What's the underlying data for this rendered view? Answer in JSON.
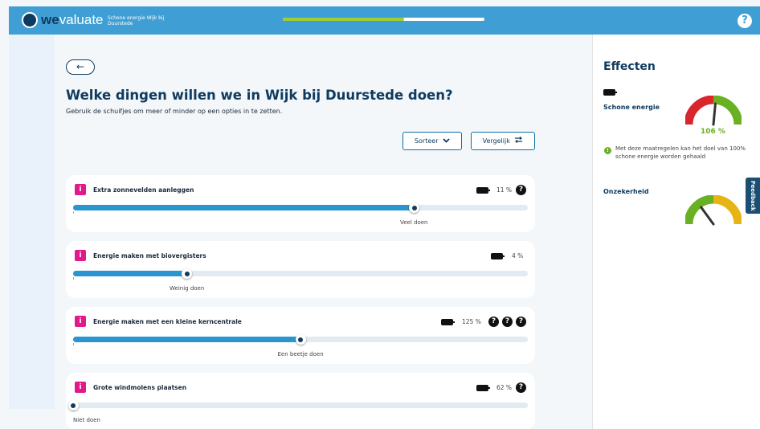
{
  "header": {
    "logo_we": "we",
    "logo_rest": "valuate",
    "project": "Schone energie Wijk bij Duurstede",
    "progress": 0.6,
    "help": "?"
  },
  "page": {
    "back": "←",
    "title": "Welke dingen willen we in Wijk bij Duurstede doen?",
    "subtitle": "Gebruik de schuifjes om meer of minder op een opties in te zetten.",
    "sort_label": "Sorteer",
    "sort_icon": "chevron-down-icon",
    "compare_label": "Vergelijk",
    "compare_icon": "swap-arrows-icon"
  },
  "options": [
    {
      "title": "Extra zonnevelden aanleggen",
      "percent": "11 %",
      "questions": 1,
      "level": 0.75,
      "level_label": "Veel doen"
    },
    {
      "title": "Energie maken met biovergisters",
      "percent": "4 %",
      "questions": 0,
      "level": 0.25,
      "level_label": "Weinig doen"
    },
    {
      "title": "Energie maken met een kleine kerncentrale",
      "percent": "125 %",
      "questions": 3,
      "level": 0.5,
      "level_label": "Een beetje doen"
    },
    {
      "title": "Grote windmolens plaatsen",
      "percent": "62 %",
      "questions": 1,
      "level": 0.0,
      "level_label": "Niet doen"
    }
  ],
  "effects": {
    "title": "Effecten",
    "energy_label": "Schone energie",
    "energy_value": "106 %",
    "energy_gauge": 0.53,
    "note": "Met deze maatregelen kan het doel van 100% schone energie worden gehaald",
    "uncertainty_label": "Onzekerheid",
    "uncertainty_gauge": 0.3,
    "feedback": "Feedback"
  },
  "colors": {
    "header": "#3f9fd4",
    "accent": "#2a95cf",
    "navy": "#0f3b60",
    "info": "#e2198a",
    "green": "#6ab023"
  }
}
